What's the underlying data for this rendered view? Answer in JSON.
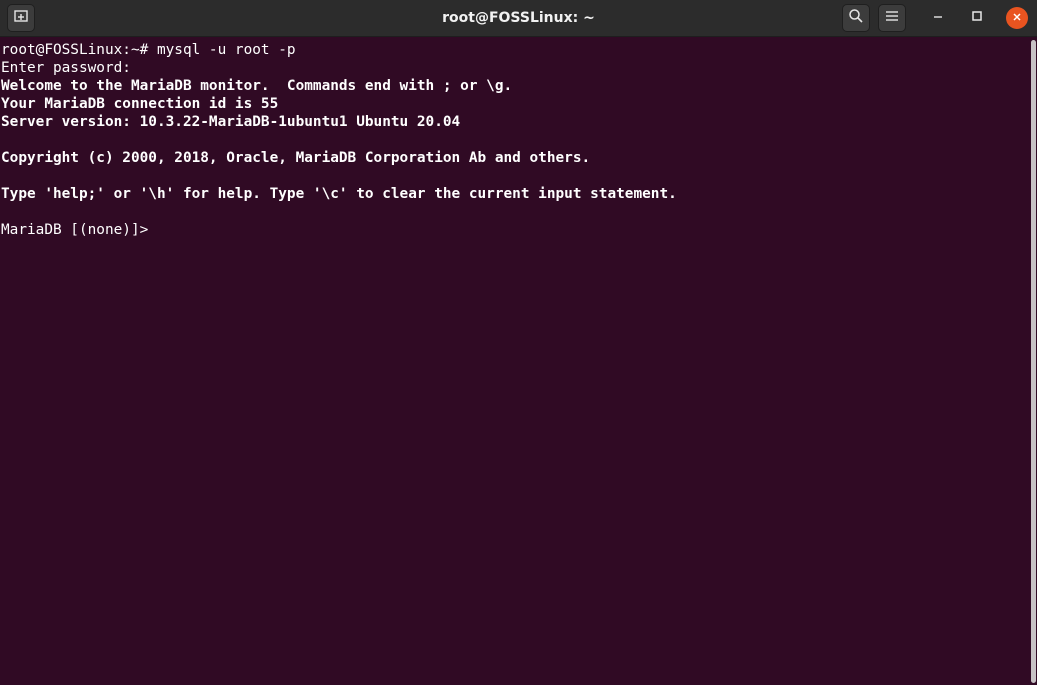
{
  "window": {
    "title": "root@FOSSLinux: ~"
  },
  "icons": {
    "new_tab": "new-tab-icon",
    "search": "search-icon",
    "menu": "hamburger-menu-icon",
    "minimize": "minimize-icon",
    "maximize": "maximize-icon",
    "close": "close-icon"
  },
  "colors": {
    "terminal_background": "#300a24",
    "titlebar_background": "#2c2c2c",
    "close_button": "#e95420",
    "text": "#ffffff"
  },
  "terminal": {
    "lines": [
      {
        "text": "root@FOSSLinux:~# mysql -u root -p",
        "bold": false
      },
      {
        "text": "Enter password:",
        "bold": false
      },
      {
        "text": "Welcome to the MariaDB monitor.  Commands end with ; or \\g.",
        "bold": true
      },
      {
        "text": "Your MariaDB connection id is 55",
        "bold": true
      },
      {
        "text": "Server version: 10.3.22-MariaDB-1ubuntu1 Ubuntu 20.04",
        "bold": true
      },
      {
        "text": "",
        "bold": false
      },
      {
        "text": "Copyright (c) 2000, 2018, Oracle, MariaDB Corporation Ab and others.",
        "bold": true
      },
      {
        "text": "",
        "bold": false
      },
      {
        "text": "Type 'help;' or '\\h' for help. Type '\\c' to clear the current input statement.",
        "bold": true
      },
      {
        "text": "",
        "bold": false
      },
      {
        "text": "MariaDB [(none)]> ",
        "bold": false
      }
    ]
  }
}
